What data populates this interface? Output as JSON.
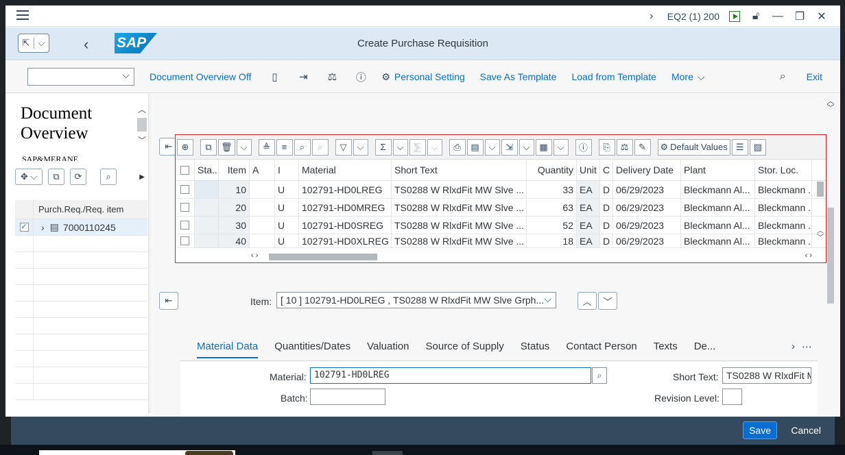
{
  "system": {
    "label": "EQ2 (1) 200"
  },
  "app": {
    "title": "Create Purchase Requisition",
    "logo": "SAP"
  },
  "toolbar": {
    "doc_overview": "Document Overview Off",
    "personal_setting": "Personal Setting",
    "save_template": "Save As Template",
    "load_template": "Load from Template",
    "more": "More",
    "exit": "Exit"
  },
  "left_panel": {
    "title_line1": "Document",
    "title_line2": "Overview",
    "subtitle": "SAP&MERANE",
    "column_header": "Purch.Req./Req. item",
    "rows": [
      {
        "label": "7000110245",
        "checked": true
      }
    ]
  },
  "grid": {
    "default_values": "Default Values",
    "headers": [
      "Sta...",
      "Item",
      "A",
      "I",
      "Material",
      "Short Text",
      "Quantity",
      "Unit",
      "C",
      "Delivery Date",
      "Plant",
      "Stor. Loc."
    ],
    "rows": [
      [
        "",
        "10",
        "",
        "U",
        "102791-HD0LREG",
        "TS0288 W RlxdFit MW Slve ...",
        "33",
        "EA",
        "D",
        "06/29/2023",
        "Bleckmann Al...",
        "Bleckmann ..."
      ],
      [
        "",
        "20",
        "",
        "U",
        "102791-HD0MREG",
        "TS0288 W RlxdFit MW Slve ...",
        "63",
        "EA",
        "D",
        "06/29/2023",
        "Bleckmann Al...",
        "Bleckmann ..."
      ],
      [
        "",
        "30",
        "",
        "U",
        "102791-HD0SREG",
        "TS0288 W RlxdFit MW Slve ...",
        "52",
        "EA",
        "D",
        "06/29/2023",
        "Bleckmann Al...",
        "Bleckmann ..."
      ],
      [
        "",
        "40",
        "",
        "U",
        "102791-HD0XLREG",
        "TS0288 W RlxdFit MW Slve ...",
        "18",
        "EA",
        "D",
        "06/29/2023",
        "Bleckmann Al...",
        "Bleckmann ..."
      ]
    ]
  },
  "item_selector": {
    "label": "Item:",
    "value": "[ 10 ] 102791-HD0LREG , TS0288 W RlxdFit MW Slve Grph..."
  },
  "tabs": [
    "Material Data",
    "Quantities/Dates",
    "Valuation",
    "Source of Supply",
    "Status",
    "Contact Person",
    "Texts",
    "De..."
  ],
  "form": {
    "material_label": "Material:",
    "material_value": "102791-HD0LREG",
    "batch_label": "Batch:",
    "batch_value": "",
    "short_text_label": "Short Text:",
    "short_text_value": "TS0288 W RlxdFit M",
    "revision_label": "Revision Level:",
    "revision_value": ""
  },
  "footer": {
    "save": "Save",
    "cancel": "Cancel"
  },
  "colors": {
    "shell": "#dce8f3",
    "footer": "#354a5f",
    "accent": "#0a6ed1",
    "highlight_border": "#e02020"
  }
}
